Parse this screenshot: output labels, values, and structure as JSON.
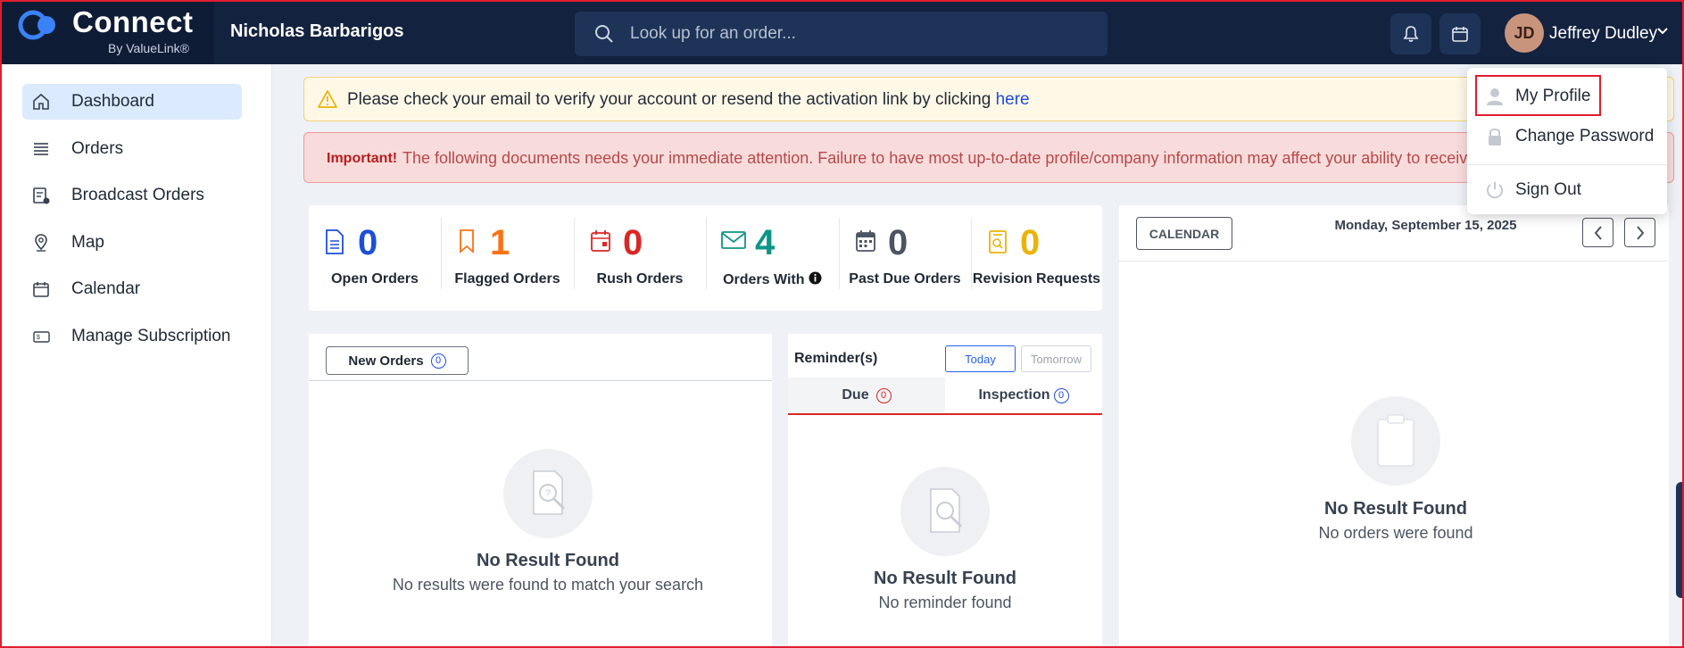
{
  "brand": {
    "name": "Connect",
    "sub": "By ValueLink®"
  },
  "company": "Nicholas Barbarigos",
  "search": {
    "placeholder": "Look up for an order..."
  },
  "user": {
    "initials": "JD",
    "name": "Jeffrey Dudley"
  },
  "sidebar": {
    "items": [
      {
        "label": "Dashboard",
        "icon": "home-icon",
        "active": true
      },
      {
        "label": "Orders",
        "icon": "list-icon"
      },
      {
        "label": "Broadcast Orders",
        "icon": "broadcast-icon"
      },
      {
        "label": "Map",
        "icon": "map-pin-icon"
      },
      {
        "label": "Calendar",
        "icon": "calendar-icon"
      },
      {
        "label": "Manage Subscription",
        "icon": "subscription-icon"
      }
    ]
  },
  "alerts": {
    "verify": {
      "text": "Please check your email to verify your account or resend the activation link by clicking ",
      "link": "here"
    },
    "important": {
      "strong": "Important!",
      "text": "The following documents needs your immediate attention. Failure to have most up-to-date profile/company information may affect your ability to receive orders."
    }
  },
  "stats": [
    {
      "value": "0",
      "label": "Open Orders",
      "color": "#1d4ed8",
      "icon": "document-icon"
    },
    {
      "value": "1",
      "label": "Flagged Orders",
      "color": "#f97316",
      "icon": "bookmark-icon"
    },
    {
      "value": "0",
      "label": "Rush Orders",
      "color": "#dc2626",
      "icon": "calendar-alert-icon"
    },
    {
      "value": "4",
      "label": "Orders With",
      "color": "#0d9488",
      "icon": "envelope-icon"
    },
    {
      "value": "0",
      "label": "Past Due Orders",
      "color": "#4b5563",
      "icon": "calendar-grid-icon"
    },
    {
      "value": "0",
      "label": "Revision Requests",
      "color": "#eab308",
      "icon": "revision-icon"
    }
  ],
  "new_orders": {
    "tab": "New Orders",
    "count": "0",
    "empty_title": "No Result Found",
    "empty_sub": "No results were found to match your search"
  },
  "reminders": {
    "title": "Reminder(s)",
    "today": "Today",
    "tomorrow": "Tomorrow",
    "tab_due": "Due",
    "due_count": "0",
    "tab_inspection": "Inspection",
    "inspection_count": "0",
    "empty_title": "No Result Found",
    "empty_sub": "No reminder found"
  },
  "calendar": {
    "button": "CALENDAR",
    "date": "Monday, September 15, 2025",
    "empty_title": "No Result Found",
    "empty_sub": "No orders were found"
  },
  "profile_menu": {
    "my_profile": "My Profile",
    "change_password": "Change Password",
    "sign_out": "Sign Out"
  }
}
